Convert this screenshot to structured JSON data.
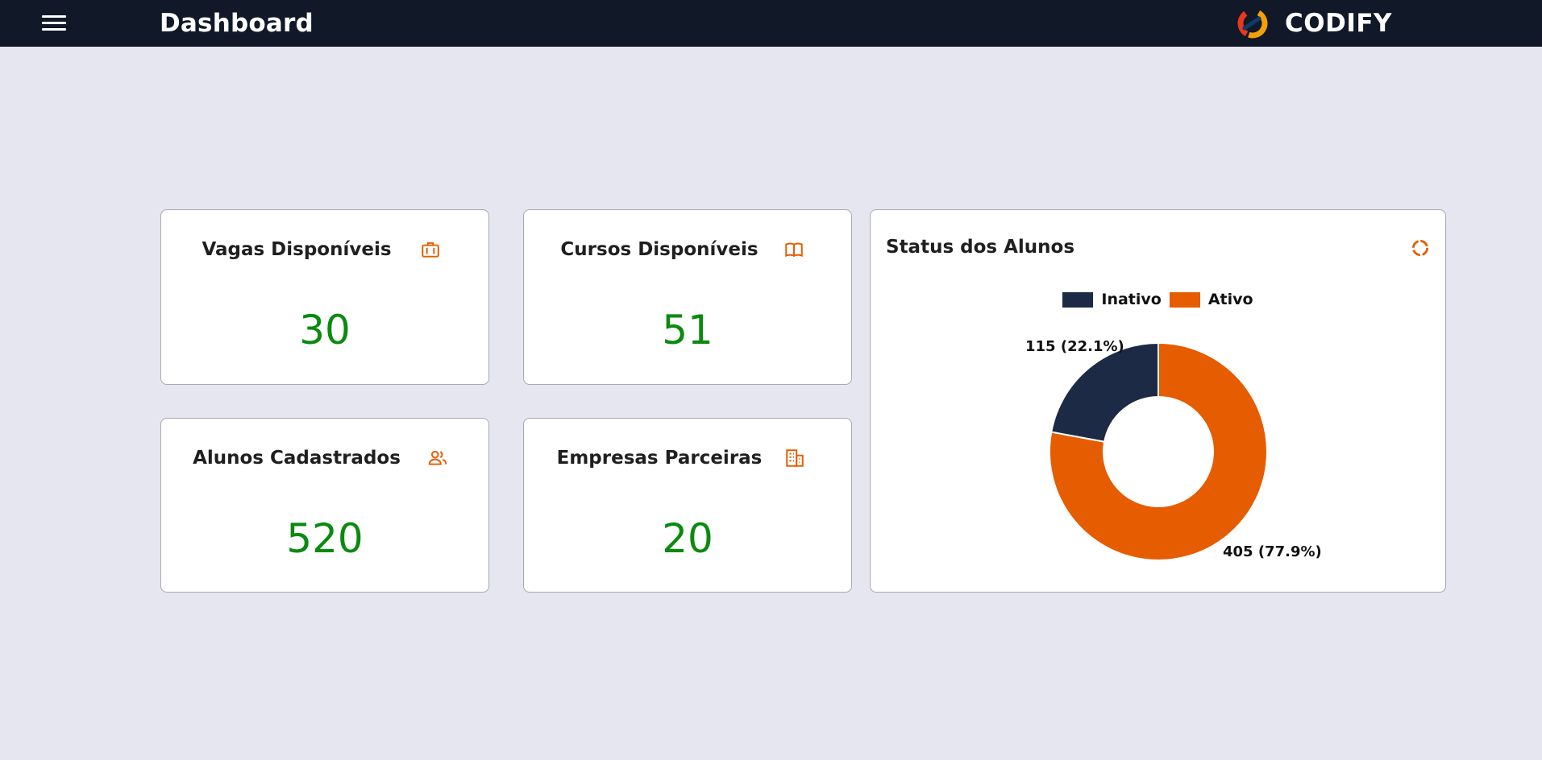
{
  "header": {
    "title": "Dashboard",
    "brand": "CODIFY",
    "menu_icon": "hamburger-menu-icon",
    "logo_icon": "codify-logo-icon"
  },
  "colors": {
    "topbar": "#111827",
    "accent": "#e65c00",
    "value": "#0b8a10",
    "inactive": "#1c2a45",
    "active": "#e65c00"
  },
  "cards": {
    "vagas": {
      "title": "Vagas Disponíveis",
      "value": "30",
      "icon": "briefcase-icon"
    },
    "cursos": {
      "title": "Cursos Disponíveis",
      "value": "51",
      "icon": "book-icon"
    },
    "alunos": {
      "title": "Alunos Cadastrados",
      "value": "520",
      "icon": "users-icon"
    },
    "empresas": {
      "title": "Empresas Parceiras",
      "value": "20",
      "icon": "building-icon"
    }
  },
  "status_card": {
    "title": "Status dos Alunos",
    "icon": "donut-chart-icon"
  },
  "chart_data": {
    "type": "pie",
    "donut": true,
    "title": "Status dos Alunos",
    "categories": [
      "Inativo",
      "Ativo"
    ],
    "values": [
      115,
      405
    ],
    "labels": [
      "115 (22.1%)",
      "405 (77.9%)"
    ],
    "colors": [
      "#1c2a45",
      "#e65c00"
    ],
    "legend": "top"
  }
}
